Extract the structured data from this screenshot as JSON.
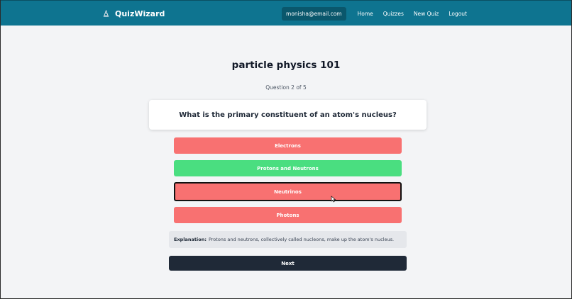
{
  "header": {
    "brand": "QuizWizard",
    "brand_icon": "wizard-hat-icon",
    "user_email": "monisha@email.com",
    "nav": [
      "Home",
      "Quizzes",
      "New Quiz",
      "Logout"
    ]
  },
  "quiz": {
    "title": "particle physics 101",
    "progress": "Question 2 of 5",
    "question": "What is the primary constituent of an atom's nucleus?",
    "options": [
      {
        "label": "Electrons",
        "status": "incorrect",
        "color": "#f87171"
      },
      {
        "label": "Protons and Neutrons",
        "status": "correct",
        "color": "#4ade80"
      },
      {
        "label": "Neutrinos",
        "status": "selected-incorrect",
        "color": "#f87171"
      },
      {
        "label": "Photons",
        "status": "incorrect",
        "color": "#f87171"
      }
    ],
    "explanation_label": "Explanation:",
    "explanation_text": "Protons and neutrons, collectively called nucleons, make up the atom's nucleus.",
    "next_label": "Next"
  },
  "colors": {
    "navbar": "#0e7490",
    "correct": "#4ade80",
    "incorrect": "#f87171",
    "next_button": "#1f2937"
  }
}
